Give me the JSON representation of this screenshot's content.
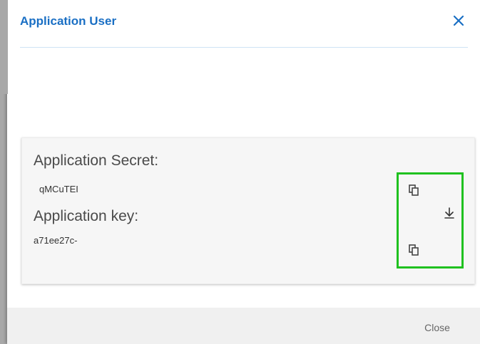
{
  "dialog": {
    "title": "Application User",
    "close_icon": "close-icon"
  },
  "credentials": {
    "secret_label": "Application Secret:",
    "secret_value": "qMCuTEI",
    "key_label": "Application key:",
    "key_value": "a71ee27c-",
    "copy_secret_icon": "copy-icon",
    "download_icon": "download-icon",
    "copy_key_icon": "copy-icon"
  },
  "footer": {
    "close_label": "Close"
  },
  "colors": {
    "title": "#1a6fc4",
    "highlight": "#1fc11f",
    "footer_bg": "#f0f0f0",
    "card_bg": "#f6f6f6"
  }
}
